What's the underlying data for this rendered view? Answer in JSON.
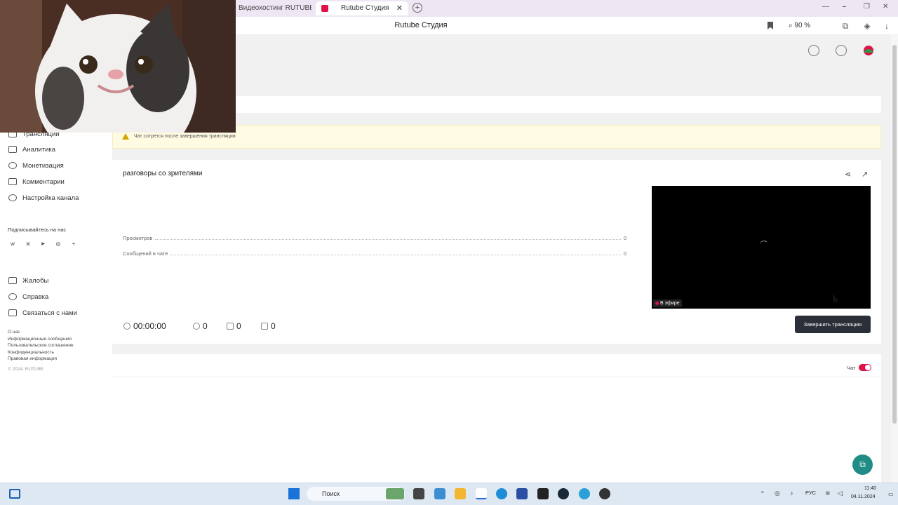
{
  "browser": {
    "tabs": [
      {
        "label": "Видеохостинг RUTUBE. С"
      },
      {
        "label": "Rutube Студия",
        "active": true
      }
    ],
    "address_title": "Rutube Студия",
    "zoom": "90 %"
  },
  "sidebar": {
    "items": [
      {
        "label": "Трансляции",
        "icon": "broadcast-icon"
      },
      {
        "label": "Аналитика",
        "icon": "chart-icon"
      },
      {
        "label": "Монетизация",
        "icon": "coin-icon"
      },
      {
        "label": "Комментарии",
        "icon": "comments-icon"
      },
      {
        "label": "Настройка канала",
        "icon": "settings-icon"
      }
    ],
    "subscribe_label": "Подписывайтесь на нас",
    "socials": [
      "vk-icon",
      "ok-icon",
      "telegram-icon",
      "viber-icon",
      "plus-icon"
    ],
    "support_items": [
      {
        "label": "Жалобы",
        "icon": "flag-icon"
      },
      {
        "label": "Справка",
        "icon": "help-icon"
      },
      {
        "label": "Связаться с нами",
        "icon": "message-icon"
      }
    ],
    "footer_links": [
      "О нас",
      "Информационные сообщения",
      "Пользовательское соглашение",
      "Конфиденциальность",
      "Правовая информация"
    ],
    "copyright": "© 2024, RUTUBE"
  },
  "warning": {
    "text": "Чат сотрется после завершения трансляции"
  },
  "stream": {
    "title": "разговоры со зрителями",
    "stats": [
      {
        "label": "Просмотров",
        "value": "0"
      },
      {
        "label": "Сообщений в чате",
        "value": "0"
      }
    ],
    "duration": "00:00:00",
    "viewers": "0",
    "likes": "0",
    "dislikes": "0",
    "live_badge": "В эфире",
    "end_button": "Завершить трансляцию"
  },
  "chat": {
    "label": "Чат",
    "enabled": true
  },
  "taskbar": {
    "search_placeholder": "Поиск",
    "lang": "РУС",
    "time": "11:40",
    "date": "04.11.2024"
  },
  "colors": {
    "accent": "#e0104a",
    "button_dark": "#2b3038",
    "fab": "#1f8d85"
  }
}
